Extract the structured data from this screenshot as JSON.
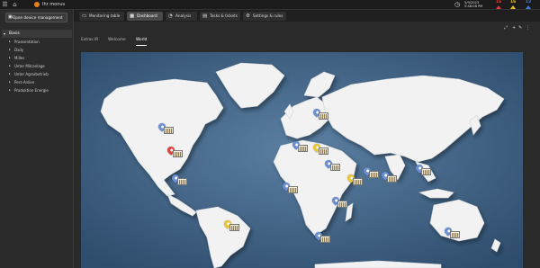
{
  "topbar": {
    "site_name": "Ihr monus",
    "time": "5:48:08 PM",
    "date": "5/9/2023",
    "alarms": [
      {
        "count": "16",
        "color": "#e03b3b"
      },
      {
        "count": "16",
        "color": "#e8c21a"
      },
      {
        "count": "12",
        "color": "#3b7de0"
      }
    ]
  },
  "sidebar": {
    "open_button": "Open device management",
    "root": "Basis",
    "items": [
      "Praesentation",
      "Daily",
      "Milles",
      "Unter Milcanlage",
      "Unter Agrarbetrieb",
      "Pers-Anlien",
      "Produktion Energie"
    ]
  },
  "tabs": [
    {
      "label": "Monitoring table",
      "icon": "▭"
    },
    {
      "label": "Dashboard",
      "icon": "▦"
    },
    {
      "label": "Analysis",
      "icon": "◔"
    },
    {
      "label": "Tasks & tickets",
      "icon": "▤"
    },
    {
      "label": "Settings & rules",
      "icon": "⚙"
    }
  ],
  "subtabs": [
    "Extras IR",
    "Welcome",
    "World"
  ],
  "active_subtab": "World",
  "colors": {
    "pin_blue": "#6b8fd4",
    "pin_yellow": "#e9c635",
    "pin_red": "#e0443a",
    "ocean": "#4a6b8c",
    "land": "#f0f0f0"
  }
}
